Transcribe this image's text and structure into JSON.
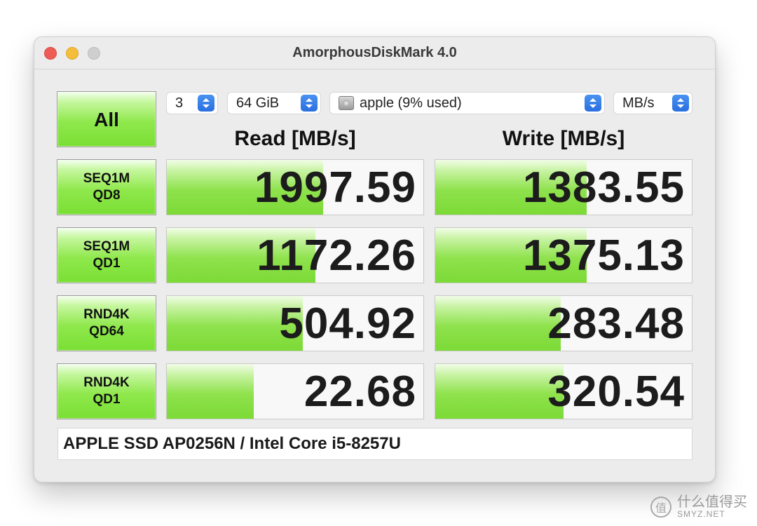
{
  "window": {
    "title": "AmorphousDiskMark 4.0"
  },
  "toolbar": {
    "all_button": "All",
    "count": "3",
    "size": "64 GiB",
    "target": "apple (9% used)",
    "unit": "MB/s"
  },
  "headers": {
    "read": "Read [MB/s]",
    "write": "Write [MB/s]"
  },
  "rows": [
    {
      "line1": "SEQ1M",
      "line2": "QD8",
      "read": "1997.59",
      "read_fill": 0.61,
      "write": "1383.55",
      "write_fill": 0.59
    },
    {
      "line1": "SEQ1M",
      "line2": "QD1",
      "read": "1172.26",
      "read_fill": 0.58,
      "write": "1375.13",
      "write_fill": 0.59
    },
    {
      "line1": "RND4K",
      "line2": "QD64",
      "read": "504.92",
      "read_fill": 0.53,
      "write": "283.48",
      "write_fill": 0.49
    },
    {
      "line1": "RND4K",
      "line2": "QD1",
      "read": "22.68",
      "read_fill": 0.34,
      "write": "320.54",
      "write_fill": 0.5
    }
  ],
  "info": "APPLE SSD AP0256N / Intel Core i5-8257U",
  "watermark": {
    "text": "什么值得买",
    "sub": "SMYZ.NET"
  },
  "colors": {
    "green": "#8fe24d",
    "close": "#ee5d55",
    "minimize": "#f5be3a",
    "stepper": "#2a6fe0"
  },
  "icons": {
    "stepper": "up-down-chevron-icon",
    "disk": "hard-disk-icon"
  }
}
